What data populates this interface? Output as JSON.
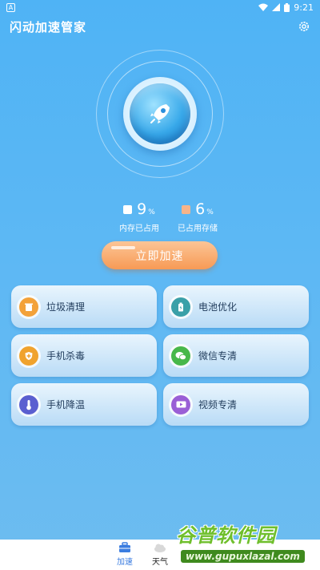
{
  "status_bar": {
    "sim": "A",
    "time": "9:21"
  },
  "header": {
    "title": "闪动加速管家",
    "settings_icon": "gear-icon"
  },
  "stats": {
    "memory": {
      "value": "9",
      "unit": "%",
      "label": "内存已占用",
      "color": "#ffffff"
    },
    "storage": {
      "value": "6",
      "unit": "%",
      "label": "已占用存储",
      "color": "#f6b48a"
    }
  },
  "accelerate_button": {
    "label": "立即加速"
  },
  "features": [
    {
      "label": "垃圾清理",
      "icon": "trash-icon",
      "color": "#f3a23a"
    },
    {
      "label": "电池优化",
      "icon": "battery-icon",
      "color": "#3aa0a8"
    },
    {
      "label": "手机杀毒",
      "icon": "shield-icon",
      "color": "#f0a32e"
    },
    {
      "label": "微信专清",
      "icon": "wechat-icon",
      "color": "#47b84a"
    },
    {
      "label": "手机降温",
      "icon": "thermometer-icon",
      "color": "#5a5fd0"
    },
    {
      "label": "视频专清",
      "icon": "video-icon",
      "color": "#9a5fd6"
    }
  ],
  "tabs": [
    {
      "label": "加速",
      "icon": "toolbox-icon",
      "active": true,
      "color": "#3c7de0"
    },
    {
      "label": "天气",
      "icon": "weather-icon",
      "active": false
    }
  ],
  "watermark": {
    "title": "谷普软件园",
    "url": "www.gupuxlazal.com"
  }
}
